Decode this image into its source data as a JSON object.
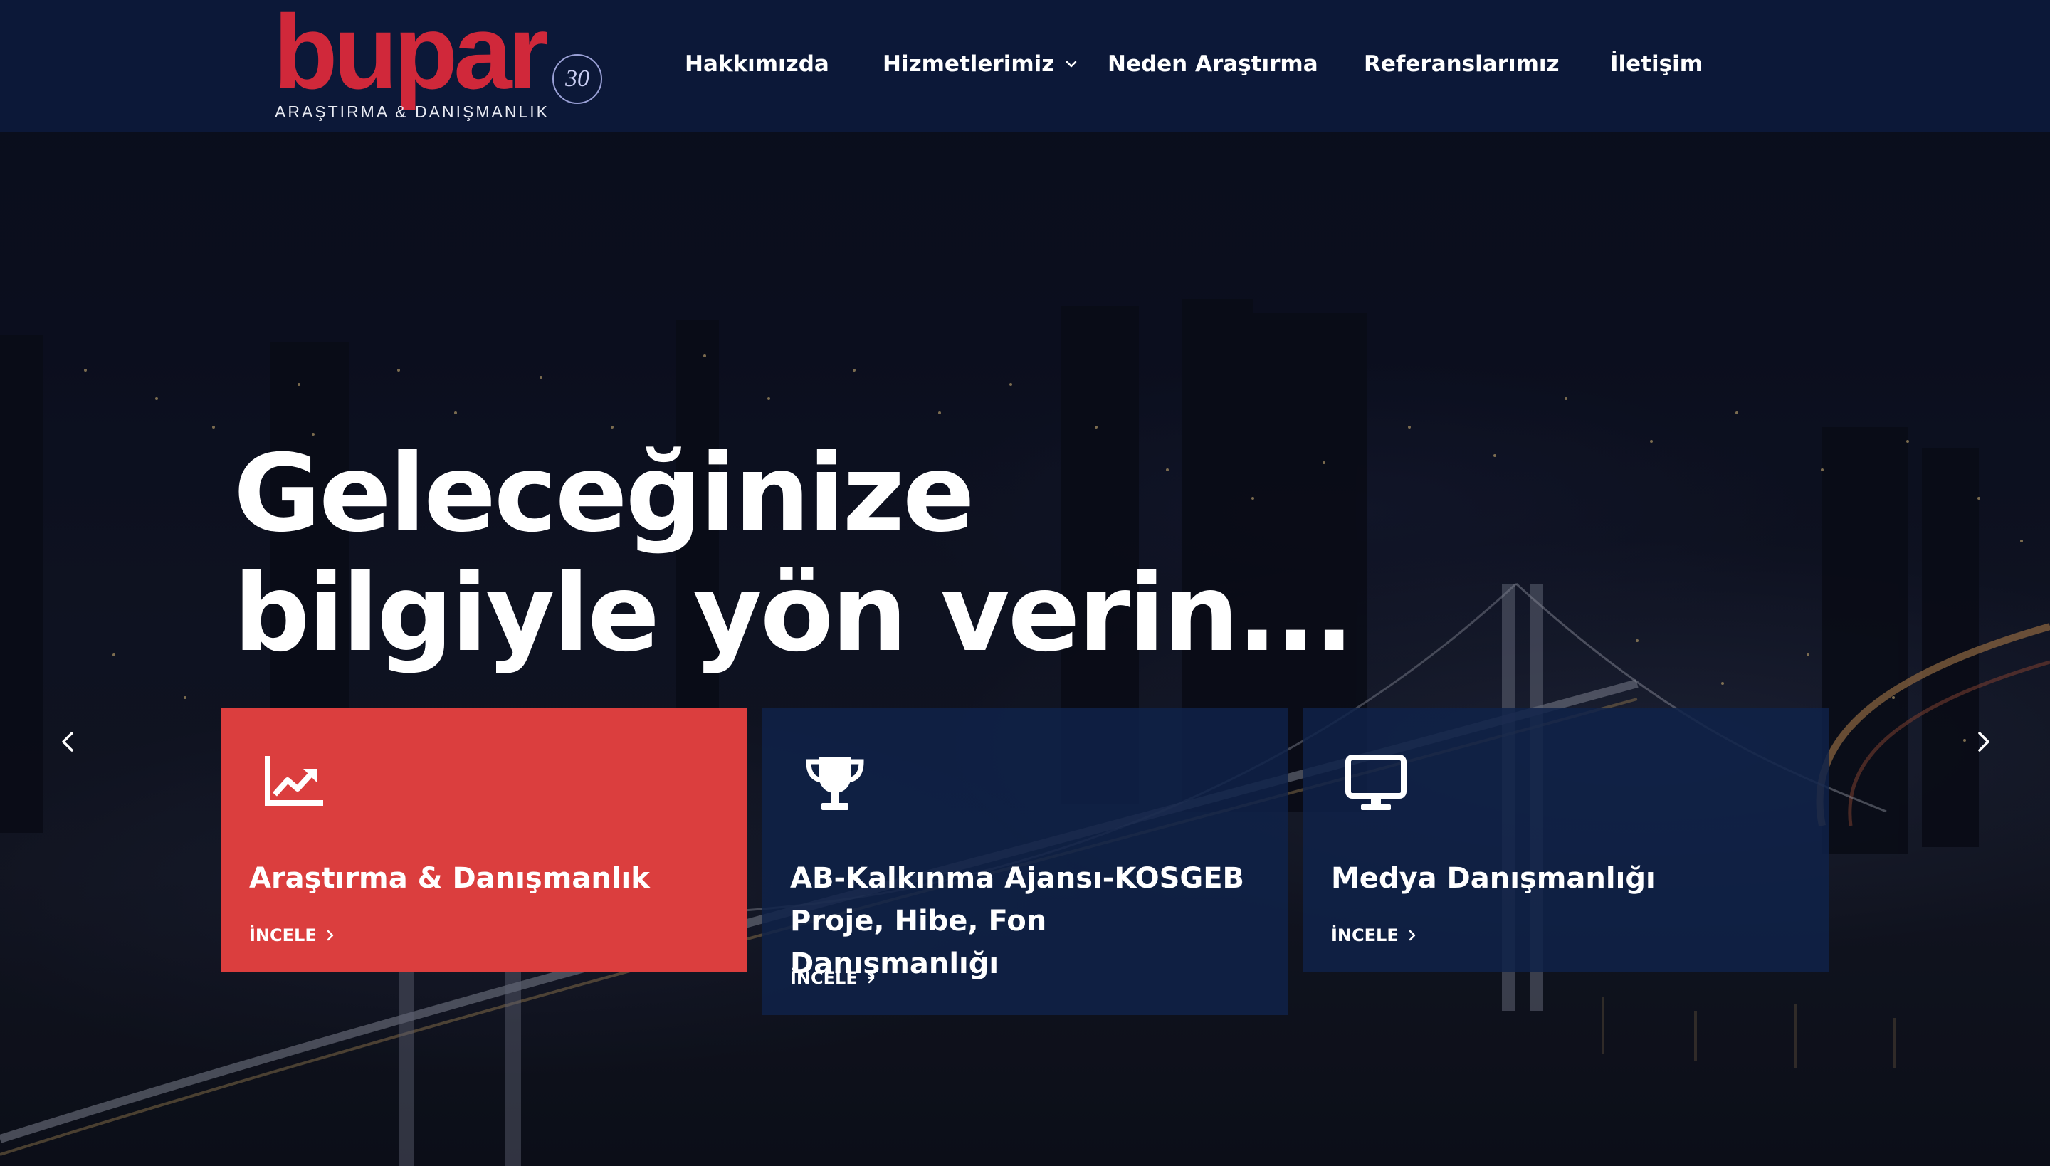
{
  "colors": {
    "header_bg": "#0c1838",
    "brand_red": "#d0283a",
    "card_active": "#db3e3e",
    "card_dark": "#0f2249"
  },
  "brand": {
    "name": "bupar",
    "badge": "30",
    "tagline": "ARAŞTIRMA & DANIŞMANLIK"
  },
  "nav": {
    "items": [
      {
        "label": "Hakkımızda"
      },
      {
        "label": "Hizmetlerimiz",
        "icon": "chevron-down-icon"
      },
      {
        "label": "Neden Araştırma"
      },
      {
        "label": "Referanslarımız"
      },
      {
        "label": "İletişim"
      }
    ]
  },
  "hero": {
    "headline_line1": "Geleceğinize",
    "headline_line2": "bilgiyle yön verin...",
    "prev_icon": "chevron-left-icon",
    "next_icon": "chevron-right-icon"
  },
  "cards": [
    {
      "icon": "line-chart-icon",
      "title": "Araştırma & Danışmanlık",
      "link": "İNCELE",
      "active": true
    },
    {
      "icon": "trophy-icon",
      "title": "AB-Kalkınma Ajansı-KOSGEB Proje, Hibe, Fon Danışmanlığı",
      "link": "İNCELE",
      "active": false
    },
    {
      "icon": "monitor-icon",
      "title": "Medya Danışmanlığı",
      "link": "İNCELE",
      "active": false
    }
  ]
}
